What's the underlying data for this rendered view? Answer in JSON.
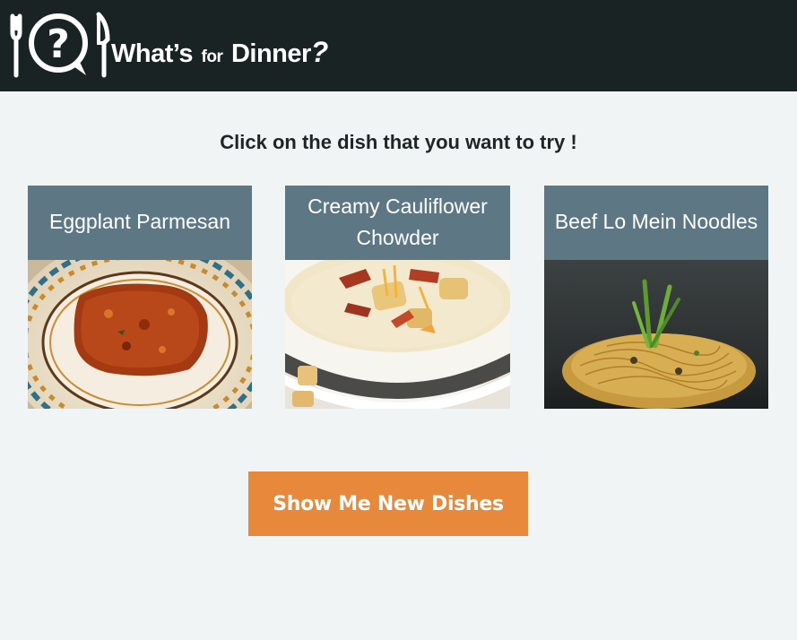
{
  "header": {
    "logo_word_1": "What’s",
    "logo_word_2": "for",
    "logo_word_3": "Dinner",
    "logo_mark": "?",
    "icon": "fork-question-knife-logo",
    "background": "#1a2324"
  },
  "main": {
    "prompt": "Click on the dish that you want to try !",
    "dishes": [
      {
        "title": "Eggplant Parmesan",
        "image": "eggplant-parmesan-photo"
      },
      {
        "title": "Creamy Cauliflower Chowder",
        "image": "cauliflower-chowder-photo"
      },
      {
        "title": "Beef Lo Mein Noodles",
        "image": "beef-lo-mein-photo"
      }
    ],
    "new_dishes_button": "Show Me New Dishes"
  },
  "colors": {
    "card_header": "#5d7884",
    "button": "#e8883a",
    "page_background": "#f1f4f5"
  }
}
